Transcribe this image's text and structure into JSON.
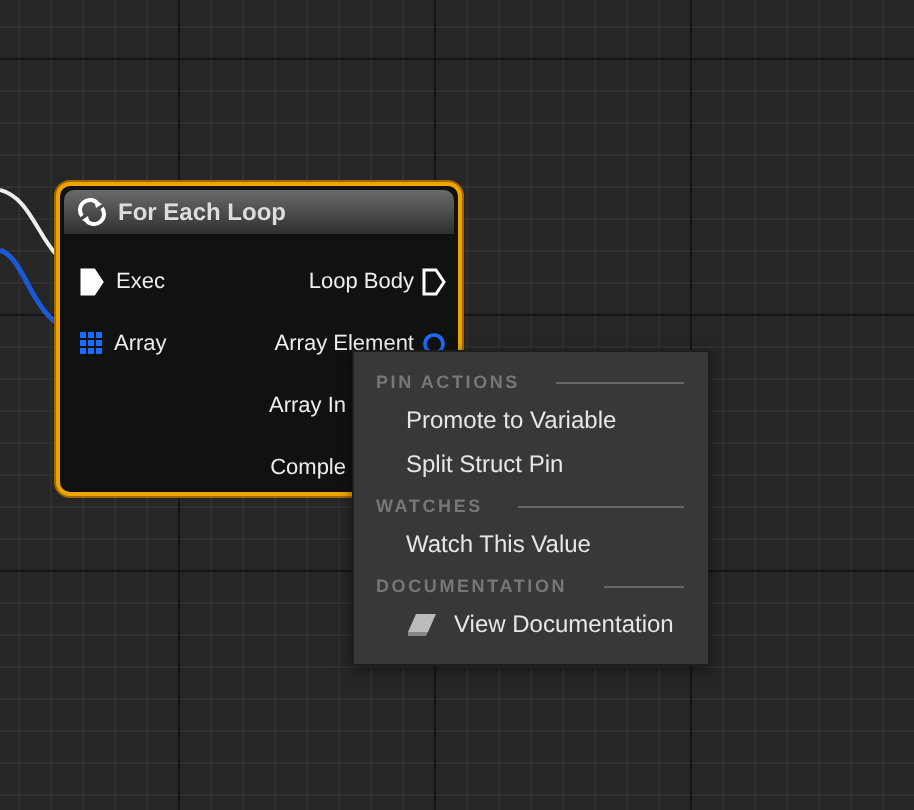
{
  "node": {
    "title": "For Each Loop",
    "selected": true,
    "inputs": [
      {
        "label": "Exec",
        "kind": "exec",
        "connected": true
      },
      {
        "label": "Array",
        "kind": "array"
      }
    ],
    "outputs": [
      {
        "label": "Loop Body",
        "kind": "exec",
        "connected": false
      },
      {
        "label": "Array Element",
        "kind": "wildcard",
        "connected": false
      },
      {
        "label": "Array In"
      },
      {
        "label": "Comple"
      }
    ]
  },
  "context_menu": {
    "sections": [
      {
        "heading": "PIN ACTIONS",
        "items": [
          {
            "label": "Promote to Variable"
          },
          {
            "label": "Split Struct Pin"
          }
        ]
      },
      {
        "heading": "WATCHES",
        "items": [
          {
            "label": "Watch This Value"
          }
        ]
      },
      {
        "heading": "DOCUMENTATION",
        "items": [
          {
            "label": "View Documentation",
            "kind": "doc"
          }
        ]
      }
    ]
  }
}
